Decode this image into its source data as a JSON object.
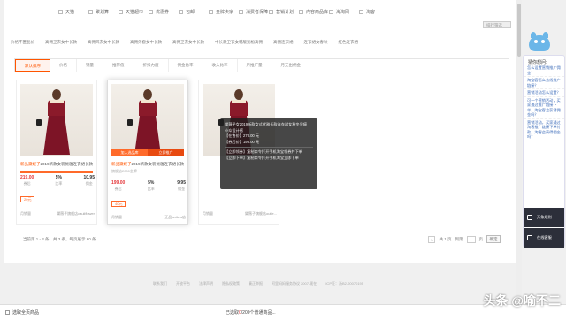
{
  "filters": [
    {
      "label": "天猫"
    },
    {
      "label": "聚划算"
    },
    {
      "label": "天猫超市"
    },
    {
      "label": "优惠券"
    },
    {
      "label": "包邮"
    },
    {
      "label": "金牌卖家"
    },
    {
      "label": "消费者保障"
    },
    {
      "label": "营销计划"
    },
    {
      "label": "内容商品库"
    },
    {
      "label": "海淘网"
    },
    {
      "label": "淘客"
    }
  ],
  "select_label": "排行筛选",
  "categories": [
    "价格不匿品价",
    "高佣卫衣女中长款",
    "高佣风衣女中长款",
    "高佣外套女中长款",
    "高佣卫衣女中长款",
    "中长款卫衣女韩版宽松高佣",
    "高佣连衣裙",
    "连衣裙女春秋",
    "红色连衣裙"
  ],
  "sort_tabs": [
    {
      "label": "默认排序",
      "active": true
    },
    {
      "label": "价格"
    },
    {
      "label": "销量"
    },
    {
      "label": "推荐值"
    },
    {
      "label": "折扣力度"
    },
    {
      "label": "佣金比率"
    },
    {
      "label": "收入比率"
    },
    {
      "label": "月推广量"
    },
    {
      "label": "月支出佣金"
    }
  ],
  "cards": [
    {
      "title_tag": "新品",
      "title_hl": "黛妮子",
      "title_rest": "2019新款女装优雅连衣裙长款",
      "shop": "黛妮子旗舰店",
      "price": "219.00",
      "rate": "5%",
      "commission": "10.95",
      "price_label": "券后",
      "rate_label": "比率",
      "commission_label": "佣金",
      "coupon": "20元",
      "foot_left": "月销量",
      "foot_right": "黛薇子旗舰店cauliflower",
      "action_left": "加入选品库",
      "action_right": "立即推广"
    },
    {
      "title_tag": "新品",
      "title_hl": "黛妮子",
      "title_rest": "2019新款女装优雅连衣裙长款",
      "shop": "旗舰店2000金牌",
      "price": "199.00",
      "rate": "5%",
      "commission": "9.95",
      "price_label": "券后",
      "rate_label": "比率",
      "commission_label": "佣金",
      "coupon": "40元",
      "foot_left": "月销量",
      "foot_right": "正品outlets店",
      "action_left": "加入选品库",
      "action_right": "立即推广"
    },
    {
      "title_tag": "新品",
      "title_hl": "黛妮子",
      "title_rest": "2019新款女装优雅连衣裙长款",
      "shop": "黛薇子旗舰店",
      "price": "",
      "rate": "",
      "commission": "",
      "price_label": "券后",
      "rate_label": "比率",
      "commission_label": "佣金",
      "coupon": "",
      "foot_left": "月销量",
      "foot_right": "黛薇子旗舰店outle...",
      "action_left": "",
      "action_right": ""
    }
  ],
  "tooltip": {
    "l1": "黛薇子女2019新款女式优雅长款连衣裙女秋冬显瘦",
    "l2": "小众设计感",
    "l3": "【在售价】279.00 元",
    "l4": "【券后价】199.00 元",
    "l5": "【立即领券】复制口令打开手机淘宝领券并下单",
    "l6": "【立即下单】复制口令打开手机淘宝立即下单"
  },
  "pager": {
    "summary": "当前第 1 - 3 条，共 3 条，每页展示 60 条",
    "page": "1",
    "total_pages": "共 1 页",
    "go_label": "到第",
    "page_unit": "页",
    "confirm": "确定"
  },
  "footer_links": [
    "联系我们",
    "开放平台",
    "法律声明",
    "隐私权政策",
    "廉正举报",
    "阿里妈妈服务协议 2007-现在",
    "ICP证：浙B2-20070195"
  ],
  "bottom": {
    "select_all": "选取全页商品",
    "selected_prefix": "已选取",
    "selected_count": "0",
    "selected_suffix": "/200个普通商品...",
    "watermark": "头条 @喻不二"
  },
  "sidebar": {
    "header": "猜你想问:",
    "questions": [
      "怎么设置营销推广佣金？",
      "淘宝客怎么去线推广链接？",
      "营销活动怎么设置？",
      "可一个营销活动，买家通过推广链接下单，淘宝客会获得佣金吗？",
      "营销活动，买家通过淘客推广链接下单付款，淘客会获得佣金吗？"
    ],
    "btn1": "万象规则",
    "btn2": "在线客服"
  }
}
